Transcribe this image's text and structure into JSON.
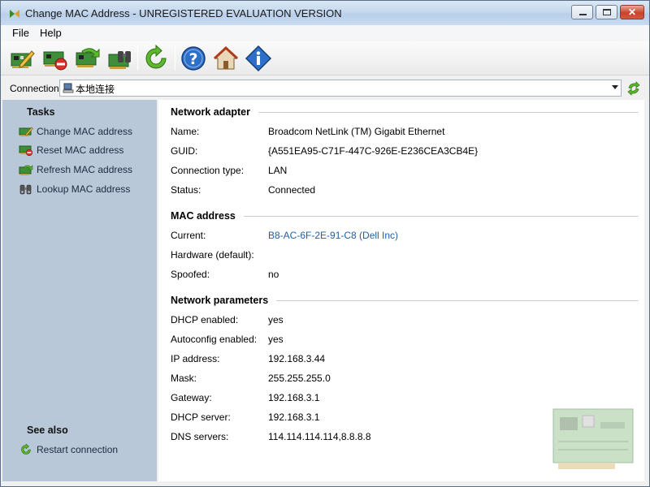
{
  "window": {
    "title": "Change MAC Address - UNREGISTERED EVALUATION VERSION"
  },
  "menu": {
    "file": "File",
    "help": "Help"
  },
  "connection": {
    "label": "Connection:",
    "value": "本地连接"
  },
  "tasks": {
    "heading": "Tasks",
    "items": [
      {
        "label": "Change MAC address",
        "icon": "card-pencil-icon"
      },
      {
        "label": "Reset MAC address",
        "icon": "card-reset-icon"
      },
      {
        "label": "Refresh MAC address",
        "icon": "card-refresh-icon"
      },
      {
        "label": "Lookup MAC address",
        "icon": "binoculars-icon"
      }
    ]
  },
  "see_also": {
    "heading": "See also",
    "items": [
      {
        "label": "Restart connection",
        "icon": "restart-icon"
      }
    ]
  },
  "network_adapter": {
    "title": "Network adapter",
    "name_label": "Name:",
    "name_value": "Broadcom NetLink (TM) Gigabit Ethernet",
    "guid_label": "GUID:",
    "guid_value": "{A551EA95-C71F-447C-926E-E236CEA3CB4E}",
    "conn_type_label": "Connection type:",
    "conn_type_value": "LAN",
    "status_label": "Status:",
    "status_value": "Connected"
  },
  "mac_address": {
    "title": "MAC address",
    "current_label": "Current:",
    "current_value": "B8-AC-6F-2E-91-C8 (Dell Inc)",
    "hardware_label": "Hardware (default):",
    "hardware_value": "",
    "spoofed_label": "Spoofed:",
    "spoofed_value": "no"
  },
  "network_parameters": {
    "title": "Network parameters",
    "dhcp_label": "DHCP enabled:",
    "dhcp_value": "yes",
    "autoconfig_label": "Autoconfig enabled:",
    "autoconfig_value": "yes",
    "ip_label": "IP address:",
    "ip_value": "192.168.3.44",
    "mask_label": "Mask:",
    "mask_value": "255.255.255.0",
    "gateway_label": "Gateway:",
    "gateway_value": "192.168.3.1",
    "dhcp_server_label": "DHCP server:",
    "dhcp_server_value": "192.168.3.1",
    "dns_label": "DNS servers:",
    "dns_value": "114.114.114.114,8.8.8.8"
  },
  "colors": {
    "task_pane": "#b8c8d9",
    "link": "#2060a8",
    "close_button": "#c8432b"
  }
}
